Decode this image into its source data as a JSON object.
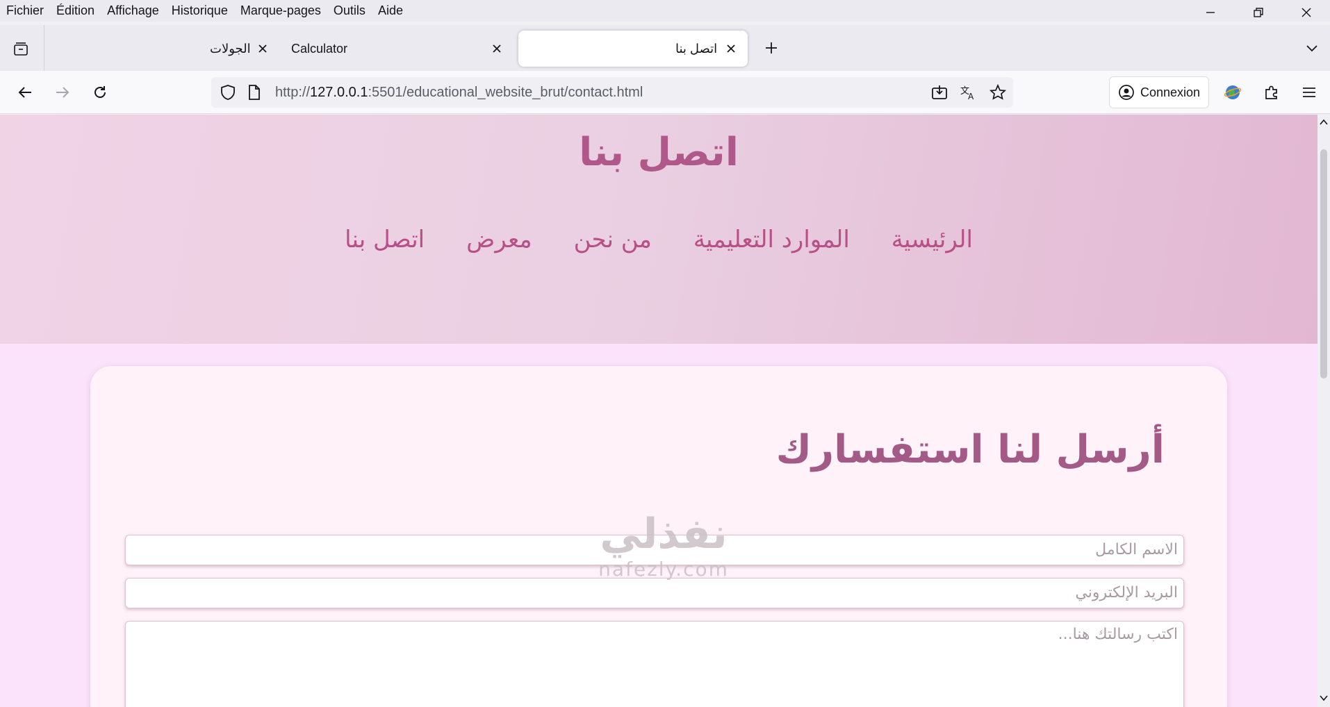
{
  "browser": {
    "menu": [
      "Fichier",
      "Édition",
      "Affichage",
      "Historique",
      "Marque-pages",
      "Outils",
      "Aide"
    ],
    "tabs": [
      {
        "title": "الجولات"
      },
      {
        "title": "Calculator"
      },
      {
        "title": "اتصل بنا"
      }
    ],
    "url": {
      "scheme": "http://",
      "host": "127.0.0.1",
      "rest": ":5501/educational_website_brut/contact.html"
    },
    "connexion_label": "Connexion"
  },
  "page": {
    "hero_title": "اتصل بنا",
    "nav": [
      "الرئيسية",
      "الموارد التعليمية",
      "من نحن",
      "معرض",
      "اتصل بنا"
    ],
    "form_title": "أرسل لنا استفسارك",
    "fields": {
      "name_placeholder": "الاسم الكامل",
      "email_placeholder": "البريد الإلكتروني",
      "message_placeholder": "اكتب رسالتك هنا..."
    },
    "watermark": {
      "arabic": "نفذلي",
      "latin": "nafezly.com"
    }
  },
  "colors": {
    "accent": "#b0588a",
    "hero_gradient_start": "#f1d3e6",
    "hero_gradient_end": "#e2b7d2",
    "page_bg": "#fbe4fb",
    "card_bg": "#fff2f8"
  }
}
